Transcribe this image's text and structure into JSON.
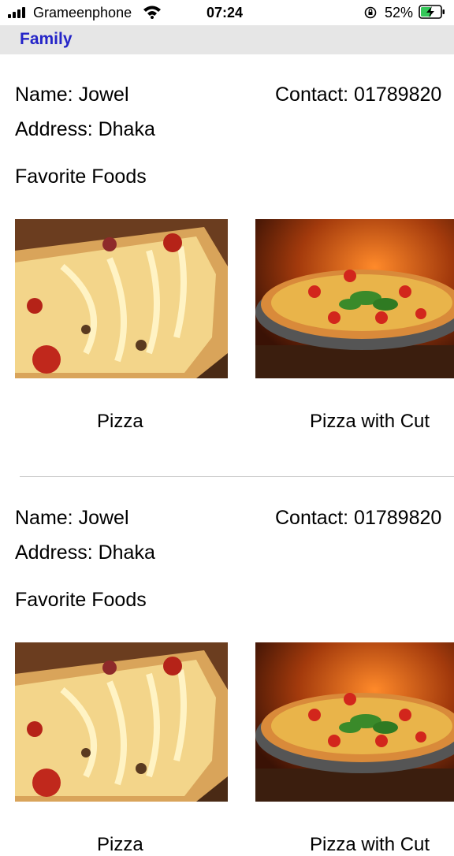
{
  "status_bar": {
    "carrier": "Grameenphone",
    "time": "07:24",
    "battery_percent": "52%",
    "battery_level": 0.52,
    "icons": [
      "signal-icon",
      "wifi-icon",
      "orientation-lock-icon",
      "battery-charging-icon"
    ]
  },
  "nav": {
    "title": "Family"
  },
  "cards": [
    {
      "name": "Name: Jowel",
      "contact": "Contact: 01789820",
      "address": "Address: Dhaka",
      "foods_title": "Favorite Foods",
      "foods": [
        {
          "label": "Pizza",
          "image": "cheesy-pizza-slice-photo"
        },
        {
          "label": "Pizza with Cut",
          "image": "basil-pizza-photo"
        }
      ]
    },
    {
      "name": "Name: Jowel",
      "contact": "Contact: 01789820",
      "address": "Address: Dhaka",
      "foods_title": "Favorite Foods",
      "foods": [
        {
          "label": "Pizza",
          "image": "cheesy-pizza-slice-photo"
        },
        {
          "label": "Pizza with Cut",
          "image": "basil-pizza-photo"
        }
      ]
    }
  ],
  "colors": {
    "nav_background": "#e6e6e6",
    "nav_title": "#2424c8",
    "separator": "#cfcfcf"
  }
}
